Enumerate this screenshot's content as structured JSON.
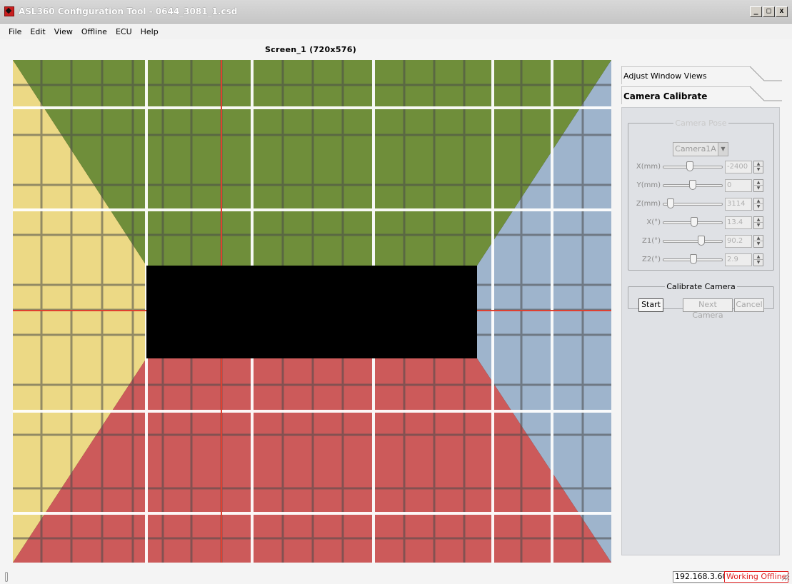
{
  "window": {
    "title": "ASL360 Configuration Tool - 0644_3081_1.csd",
    "minimize": "_",
    "maximize": "□",
    "close": "x"
  },
  "menu": [
    "File",
    "Edit",
    "View",
    "Offline",
    "ECU",
    "Help"
  ],
  "screen": {
    "title": "Screen_1  (720x576)",
    "colors": {
      "top": "#6f8e3a",
      "bottom": "#cc5a5a",
      "left": "#ecd985",
      "right": "#9eb4cc",
      "center": "#000000",
      "grid_white": "#ffffff",
      "grid_red": "#e04030"
    }
  },
  "panel": {
    "tabs": [
      "Adjust Window Views",
      "Camera Calibrate"
    ],
    "active_tab": "Camera Calibrate",
    "camera_pose": {
      "legend": "Camera Pose",
      "camera_select": "Camera1A",
      "params": [
        {
          "label": "X(mm)",
          "value": "-2400",
          "slider_fraction": 0.45
        },
        {
          "label": "Y(mm)",
          "value": "0",
          "slider_fraction": 0.5
        },
        {
          "label": "Z(mm)",
          "value": "3114",
          "slider_fraction": 0.08
        },
        {
          "label": "X(°)",
          "value": "13.4",
          "slider_fraction": 0.53
        },
        {
          "label": "Z1(°)",
          "value": "90.2",
          "slider_fraction": 0.66
        },
        {
          "label": "Z2(°)",
          "value": "2.9",
          "slider_fraction": 0.51
        }
      ]
    },
    "calibrate": {
      "legend": "Calibrate Camera",
      "start": "Start",
      "next": "Next Camera",
      "cancel": "Cancel"
    }
  },
  "status": {
    "ip": "192.168.3.60",
    "mode": "Working Offline"
  }
}
